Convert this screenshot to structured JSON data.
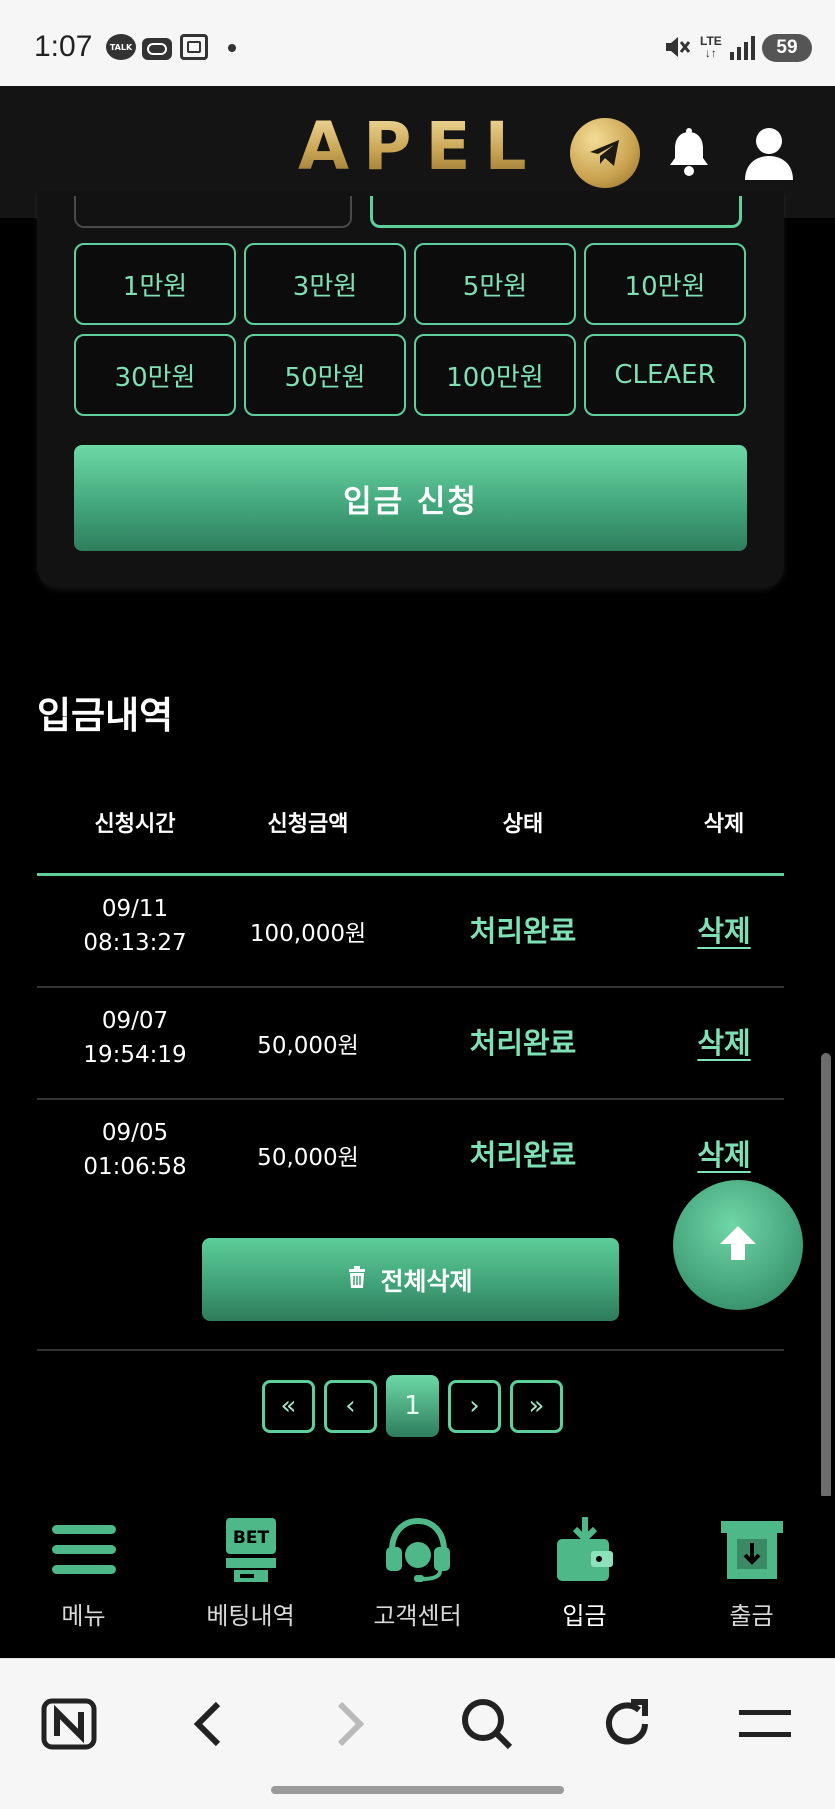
{
  "status_bar": {
    "time": "1:07",
    "talk_badge": "TALK",
    "network": "LTE",
    "battery": "59"
  },
  "header": {
    "logo_text": "APEL",
    "icons": [
      "telegram-icon",
      "bell-icon",
      "user-icon"
    ]
  },
  "deposit_form": {
    "amount_buttons": [
      "1만원",
      "3만원",
      "5만원",
      "10만원",
      "30만원",
      "50만원",
      "100만원",
      "CLEAER"
    ],
    "apply_label": "입금 신청"
  },
  "history": {
    "title": "입금내역",
    "columns": [
      "신청시간",
      "신청금액",
      "상태",
      "삭제"
    ],
    "rows": [
      {
        "date": "09/11",
        "time": "08:13:27",
        "amount": "100,000원",
        "status": "처리완료",
        "delete": "삭제"
      },
      {
        "date": "09/07",
        "time": "19:54:19",
        "amount": "50,000원",
        "status": "처리완료",
        "delete": "삭제"
      },
      {
        "date": "09/05",
        "time": "01:06:58",
        "amount": "50,000원",
        "status": "처리완료",
        "delete": "삭제"
      }
    ],
    "delete_all_label": "전체삭제"
  },
  "pagination": {
    "first": "«",
    "prev": "‹",
    "current": "1",
    "next": "›",
    "last": "»"
  },
  "bottom_nav": {
    "items": [
      {
        "label": "메뉴",
        "icon": "menu-icon"
      },
      {
        "label": "베팅내역",
        "icon": "bet-icon",
        "icon_text": "BET"
      },
      {
        "label": "고객센터",
        "icon": "headset-icon"
      },
      {
        "label": "입금",
        "icon": "deposit-wallet-icon",
        "active": true
      },
      {
        "label": "출금",
        "icon": "withdraw-icon"
      }
    ]
  },
  "browser_toolbar": {
    "icons": [
      "naver-n-icon",
      "back-icon",
      "forward-icon",
      "search-icon",
      "refresh-icon",
      "menu-icon"
    ]
  },
  "colors": {
    "accent": "#5fcf9b",
    "accent_text": "#7fe0b6",
    "gold": "#c9a554",
    "background": "#000000"
  }
}
